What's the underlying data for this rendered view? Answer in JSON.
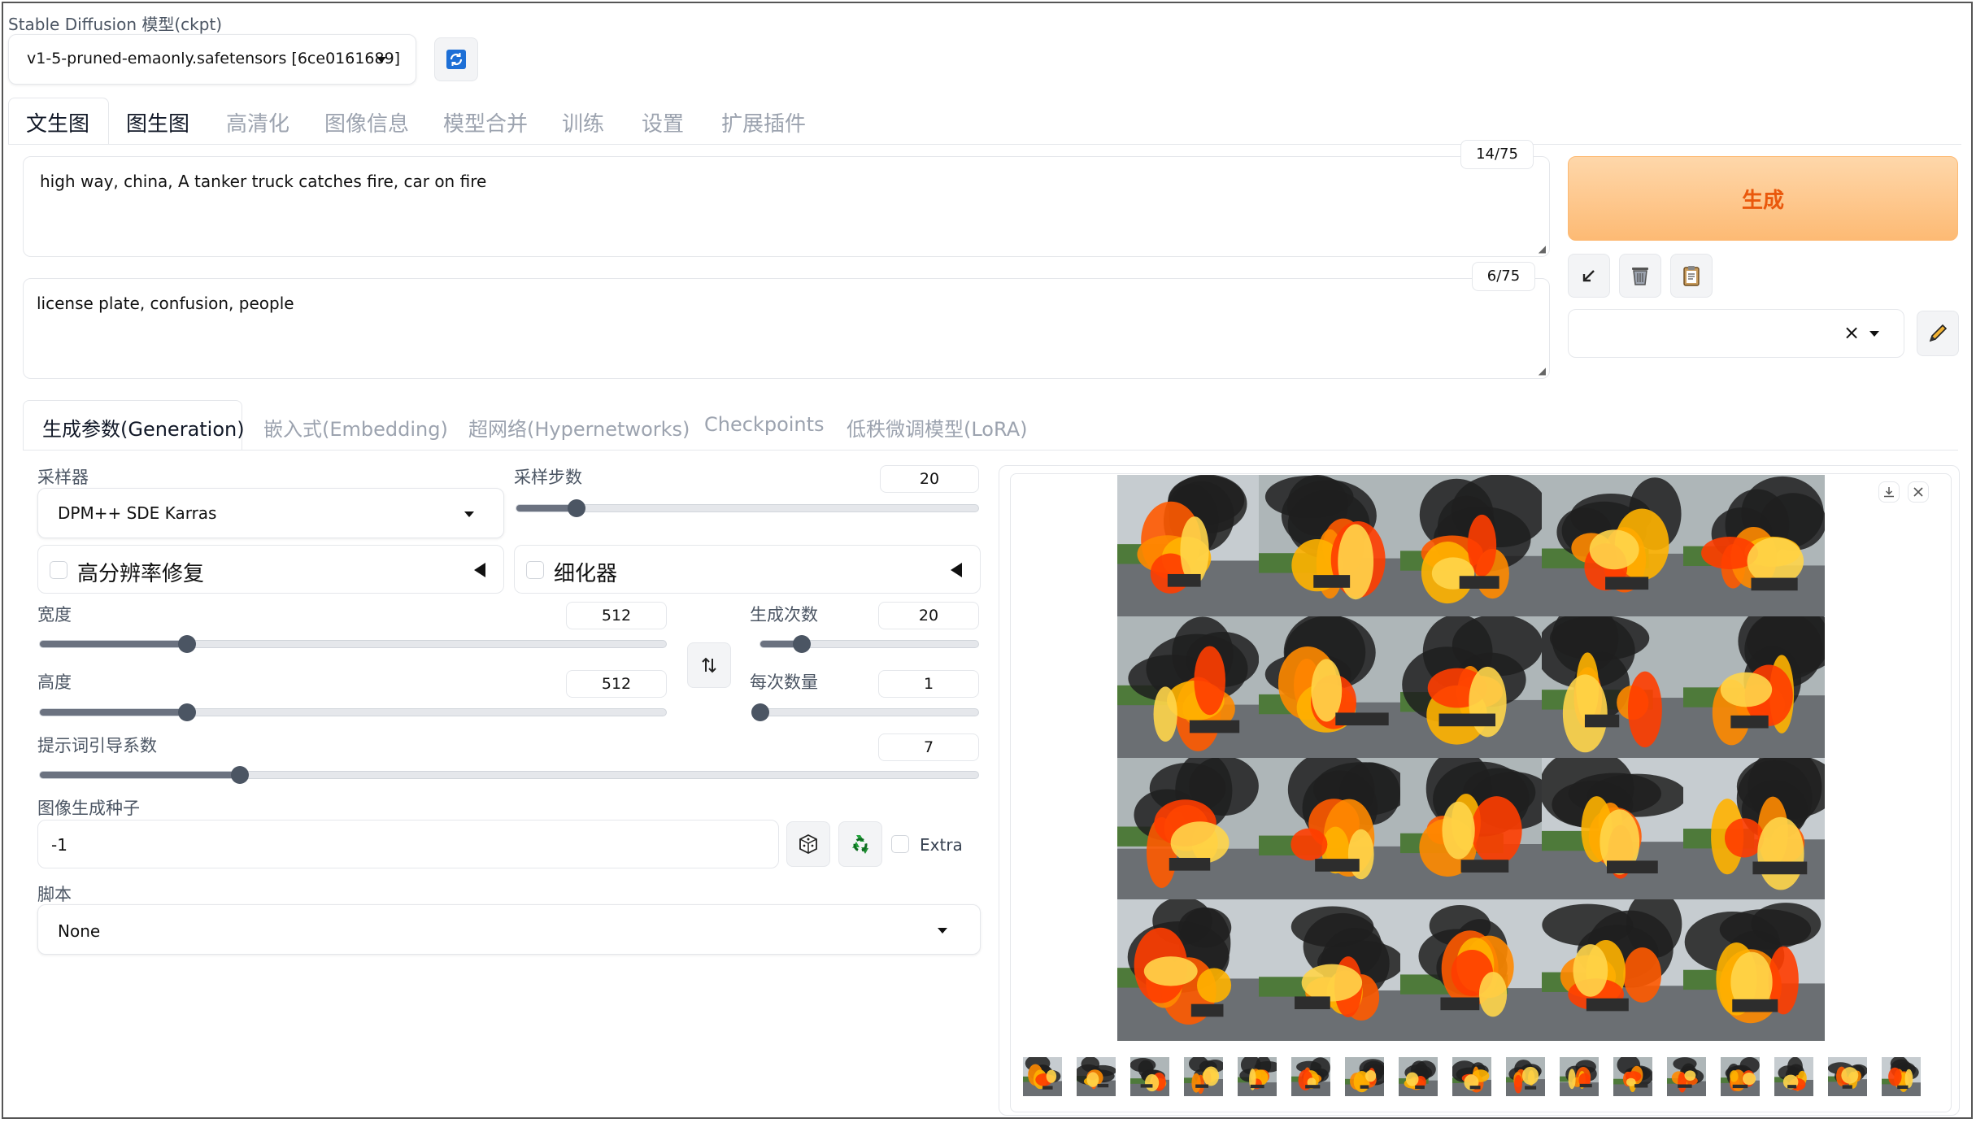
{
  "model": {
    "label": "Stable Diffusion 模型(ckpt)",
    "value": "v1-5-pruned-emaonly.safetensors [6ce0161689]"
  },
  "main_tabs": [
    "文生图",
    "图生图",
    "高清化",
    "图像信息",
    "模型合并",
    "训练",
    "设置",
    "扩展插件"
  ],
  "prompt": {
    "positive": "high way, china, A tanker truck catches fire, car on fire",
    "positive_count": "14/75",
    "negative": "license plate, confusion, people",
    "negative_count": "6/75"
  },
  "generate": {
    "label": "生成"
  },
  "style_select": {
    "clear": "×"
  },
  "sub_tabs": [
    "生成参数(Generation)",
    "嵌入式(Embedding)",
    "超网络(Hypernetworks)",
    "Checkpoints",
    "低秩微调模型(LoRA)"
  ],
  "params": {
    "sampler_label": "采样器",
    "sampler_value": "DPM++ SDE Karras",
    "steps_label": "采样步数",
    "steps_value": "20",
    "steps_fraction": 0.13,
    "hires_label": "高分辨率修复",
    "refiner_label": "细化器",
    "width_label": "宽度",
    "width_value": "512",
    "width_fraction": 0.235,
    "height_label": "高度",
    "height_value": "512",
    "height_fraction": 0.235,
    "batch_count_label": "生成次数",
    "batch_count_value": "20",
    "batch_count_fraction": 0.19,
    "batch_size_label": "每次数量",
    "batch_size_value": "1",
    "batch_size_fraction": 0.0,
    "cfg_label": "提示词引导系数",
    "cfg_value": "7",
    "cfg_fraction": 0.213,
    "seed_label": "图像生成种子",
    "seed_value": "-1",
    "extra_label": "Extra",
    "script_label": "脚本",
    "script_value": "None"
  },
  "icons": {
    "refresh": "refresh-icon",
    "arrow": "arrow-down-left-icon",
    "trash": "trash-icon",
    "clipboard": "clipboard-icon",
    "pencil": "pencil-icon",
    "swap": "swap-icon",
    "dice": "dice-icon",
    "recycle": "recycle-icon",
    "download": "download-icon",
    "close": "close-icon"
  },
  "colors": {
    "generate_bg": "#fdba74",
    "generate_text": "#ea580c",
    "accent": "#f97316"
  }
}
